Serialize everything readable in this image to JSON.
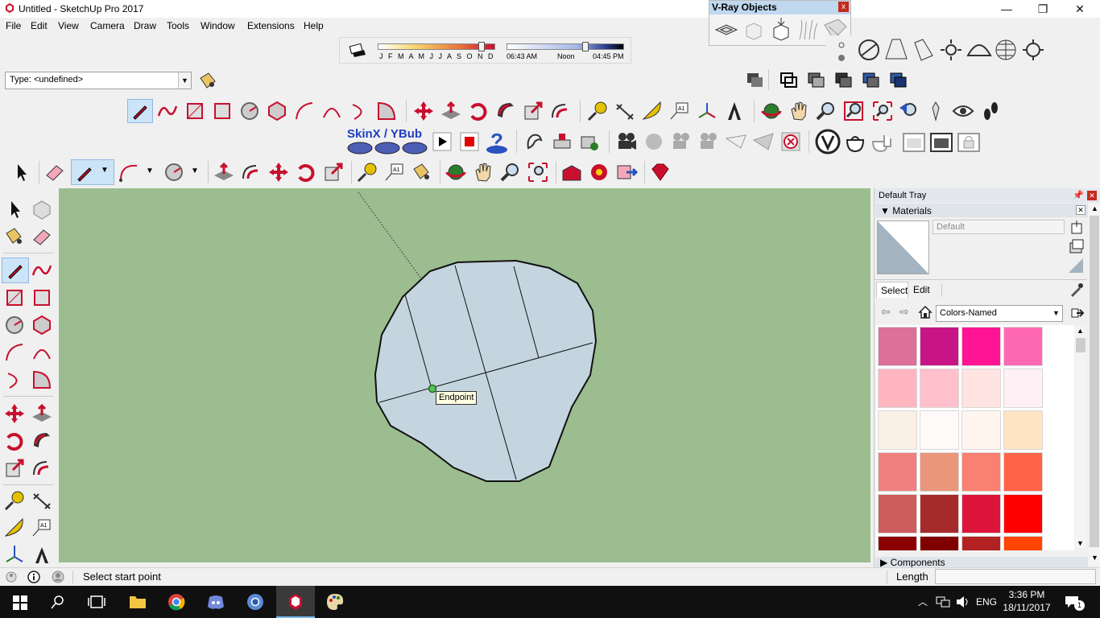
{
  "window": {
    "title": "Untitled - SketchUp Pro 2017",
    "minimize": "—",
    "maximize": "❐",
    "close": "✕"
  },
  "menu": [
    "File",
    "Edit",
    "View",
    "Camera",
    "Draw",
    "Tools",
    "Window",
    "Extensions",
    "Help"
  ],
  "shadows": {
    "months": "J F M A M J J A S O N D",
    "time_start": "06:43 AM",
    "time_mid": "Noon",
    "time_end": "04:45 PM"
  },
  "vray": {
    "title": "V-Ray Objects",
    "close": "x"
  },
  "type_box": {
    "value": "Type: <undefined>",
    "dropdown": "▼"
  },
  "skinx": {
    "label": "SkinX / YBub"
  },
  "viewport": {
    "tooltip": "Endpoint",
    "background": "#9bbd8f",
    "face_color": "#c5d5e0"
  },
  "tray": {
    "title": "Default Tray",
    "materials_header": "Materials",
    "material_name": "Default",
    "tab_select": "Select",
    "tab_edit": "Edit",
    "library": "Colors-Named",
    "components_header": "Components",
    "swatches": [
      [
        "#dc7099",
        "#c71585",
        "#ff1493",
        "#ff69b4"
      ],
      [
        "#ffb6c1",
        "#ffc0cb",
        "#ffe4e1",
        "#fff0f5"
      ],
      [
        "#faf0e6",
        "#fffafa",
        "#fff5ee",
        "#ffe4c4"
      ],
      [
        "#f08080",
        "#e9967a",
        "#fa8072",
        "#ff6347"
      ],
      [
        "#cd5c5c",
        "#a52a2a",
        "#dc143c",
        "#ff0000"
      ],
      [
        "#8b0000",
        "#800000",
        "#b22222",
        "#ff4500"
      ]
    ]
  },
  "status": {
    "text": "Select start point",
    "length_label": "Length",
    "length_value": ""
  },
  "taskbar": {
    "lang": "ENG",
    "time": "3:36 PM",
    "date": "18/11/2017",
    "notifications": "1"
  }
}
